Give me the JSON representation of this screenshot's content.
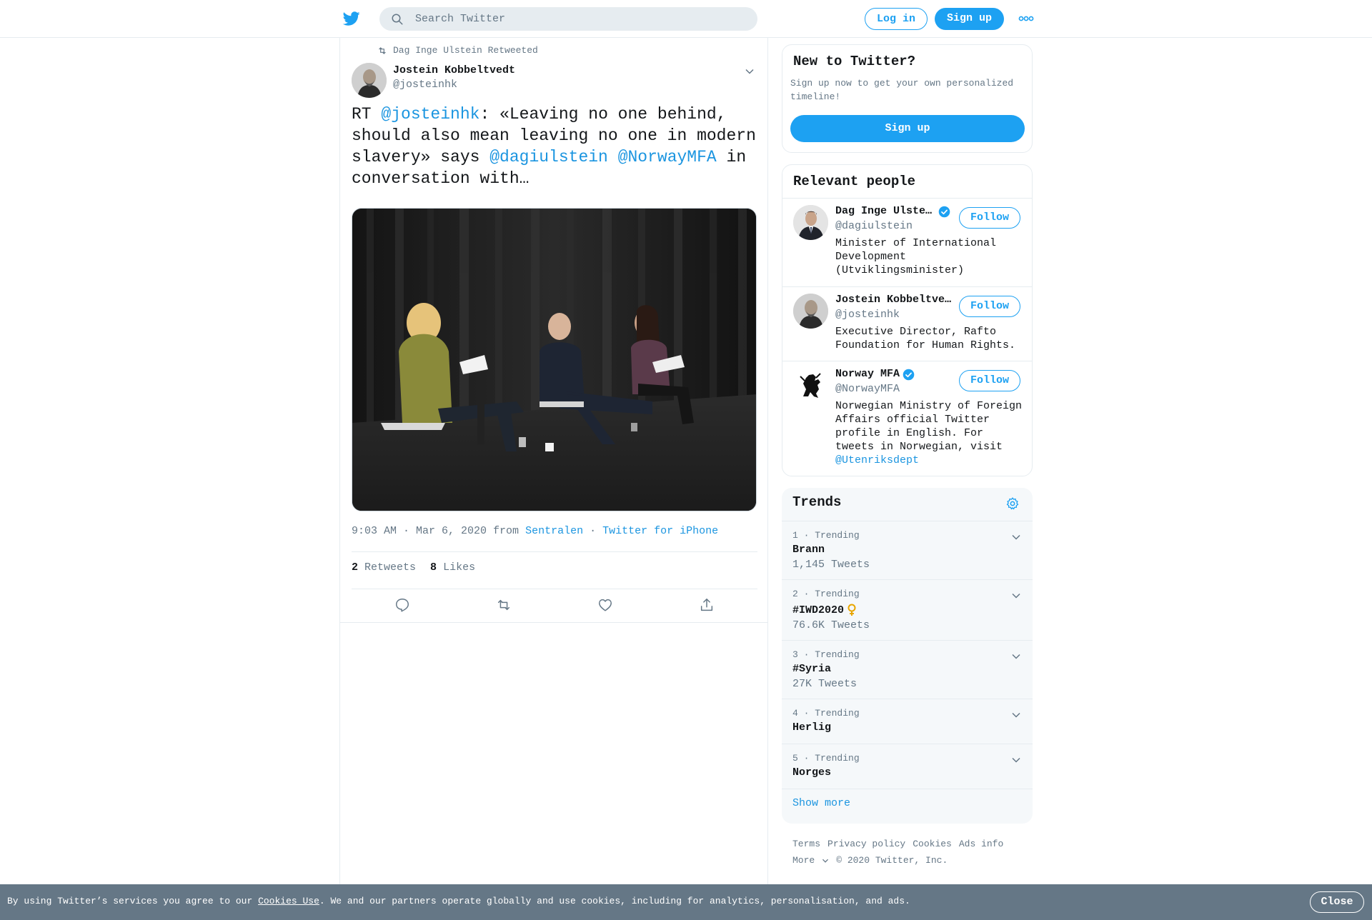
{
  "header": {
    "search_placeholder": "Search Twitter",
    "login_label": "Log in",
    "signup_label": "Sign up"
  },
  "tweet": {
    "retweeted_by": "Dag Inge Ulstein Retweeted",
    "author_name": "Jostein Kobbeltvedt",
    "author_handle": "@josteinhk",
    "text_parts": {
      "p1": "RT ",
      "m1": "@josteinhk",
      "p2": ": «Leaving no one behind, should also mean leaving no one in modern slavery» says ",
      "m2": "@dagiulstein",
      "p3": " ",
      "m3": "@NorwayMFA",
      "p4": " in conversation with…"
    },
    "timestamp": "9:03 AM · Mar 6, 2020",
    "from_label": "from",
    "source_location": "Sentralen",
    "source_sep": "·",
    "source_client": "Twitter for iPhone",
    "retweets_count": "2",
    "retweets_label": "Retweets",
    "likes_count": "8",
    "likes_label": "Likes"
  },
  "sidebar": {
    "new_to_twitter": {
      "title": "New to Twitter?",
      "description": "Sign up now to get your own personalized timeline!",
      "button": "Sign up"
    },
    "relevant_people": {
      "title": "Relevant people",
      "follow_label": "Follow",
      "people": [
        {
          "name": "Dag Inge Ulste…",
          "handle": "@dagiulstein",
          "bio": "Minister of International Development (Utviklingsminister)"
        },
        {
          "name": "Jostein Kobbeltve…",
          "handle": "@josteinhk",
          "bio": "Executive Director, Rafto Foundation for Human Rights."
        },
        {
          "name": "Norway MFA",
          "handle": "@NorwayMFA",
          "bio": "Norwegian Ministry of Foreign Affairs official Twitter profile in English. For tweets in Norwegian, visit ",
          "bio_mention": "@Utenriksdept"
        }
      ]
    },
    "trends": {
      "title": "Trends",
      "items": [
        {
          "meta": "1 · Trending",
          "name": "Brann",
          "count": "1,145 Tweets"
        },
        {
          "meta": "2 · Trending",
          "name": "#IWD2020",
          "count": "76.6K Tweets"
        },
        {
          "meta": "3 · Trending",
          "name": "#Syria",
          "count": "27K Tweets"
        },
        {
          "meta": "4 · Trending",
          "name": "Herlig",
          "count": ""
        },
        {
          "meta": "5 · Trending",
          "name": "Norges",
          "count": ""
        }
      ],
      "show_more": "Show more"
    },
    "footer": {
      "terms": "Terms",
      "privacy": "Privacy policy",
      "cookies": "Cookies",
      "ads": "Ads info",
      "more": "More",
      "copyright": "© 2020 Twitter, Inc."
    }
  },
  "cookie_bar": {
    "text_before": "By using Twitter’s services you agree to our ",
    "link": "Cookies Use",
    "text_after": ". We and our partners operate globally and use cookies, including for analytics, personalisation, and ads.",
    "close": "Close"
  },
  "colors": {
    "brand_blue": "#1da1f2",
    "link_blue": "#1b95e0",
    "secondary_text": "#657786",
    "cookie_bar_bg": "#657786"
  }
}
